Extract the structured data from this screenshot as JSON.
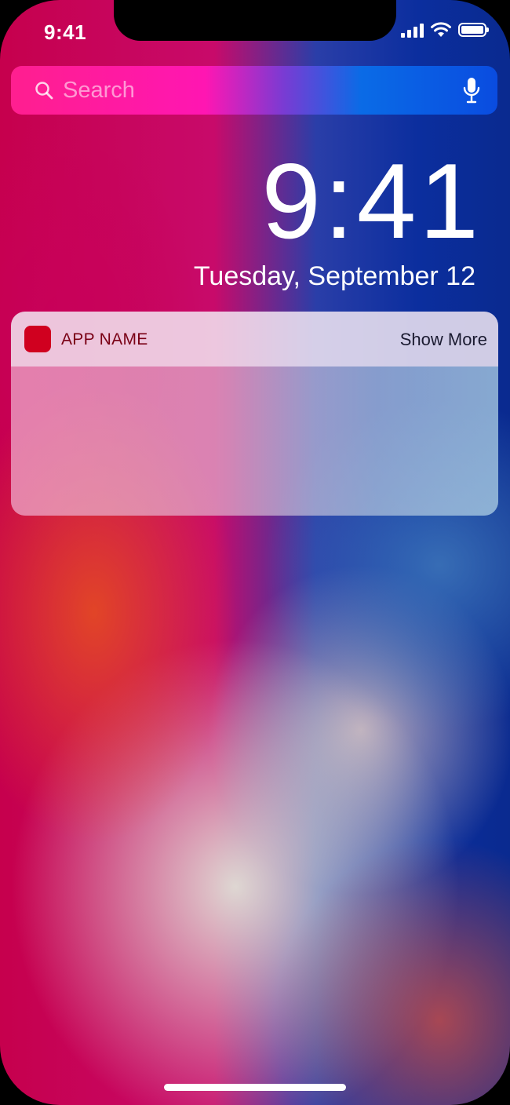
{
  "status_bar": {
    "time": "9:41",
    "icons": [
      "cellular-signal-icon",
      "wifi-icon",
      "battery-icon"
    ]
  },
  "search": {
    "placeholder": "Search",
    "icons": [
      "search-icon",
      "microphone-icon"
    ]
  },
  "lock_screen": {
    "time": "9:41",
    "date": "Tuesday, September 12"
  },
  "notification": {
    "app_name": "APP NAME",
    "show_more": "Show More",
    "app_icon_color": "#d0001f"
  },
  "colors": {
    "accent_pink": "#ff16b2",
    "accent_blue": "#0a4ce0"
  }
}
